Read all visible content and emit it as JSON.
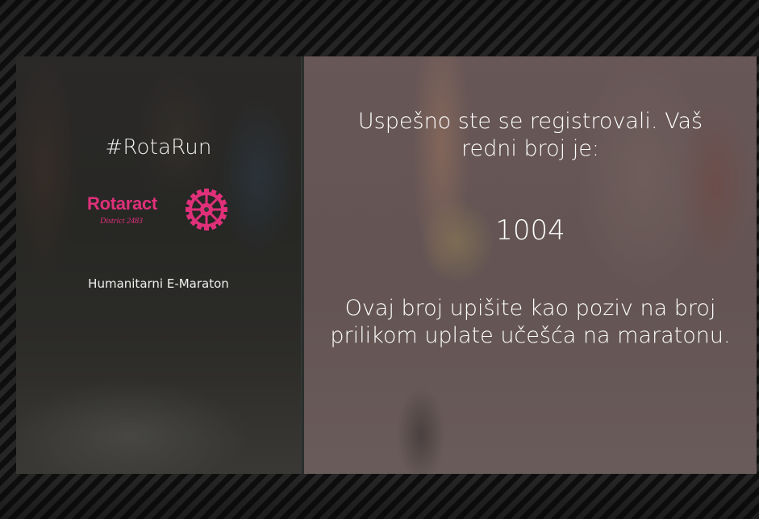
{
  "left": {
    "hashtag": "#RotaRun",
    "logo_word": "Rotaract",
    "logo_sub": "District 2483",
    "event_name": "Humanitarni E-Maraton"
  },
  "right": {
    "success_message": "Uspešno ste se registrovali. Vaš redni broj je:",
    "registration_number": "1004",
    "instruction_message": "Ovaj broj upišite kao poziv na broj prilikom uplate učešća na maratonu."
  },
  "colors": {
    "brand_pink": "#e0307a",
    "text": "#ffffff"
  },
  "icons": {
    "logo_wheel": "rotary-wheel-icon"
  }
}
